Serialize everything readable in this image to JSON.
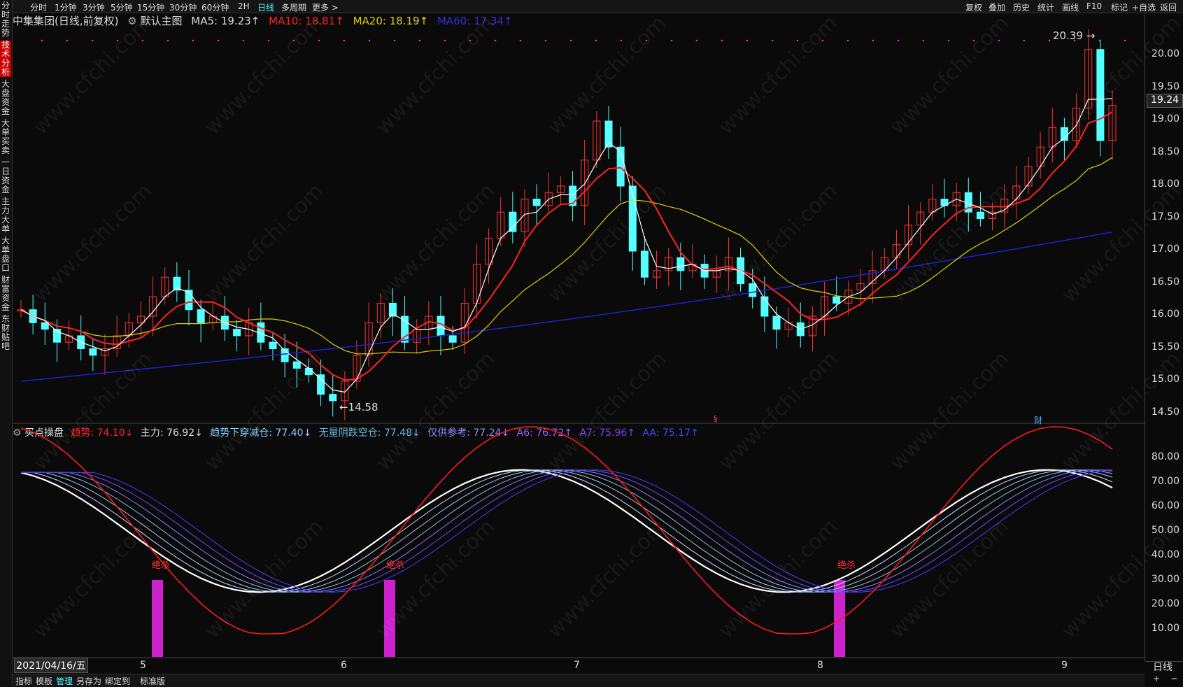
{
  "left_tabs": [
    "分时走势",
    "技术分析",
    "大盘资金",
    "大单买卖",
    "一日资金",
    "主力大单",
    "大单盘口",
    "财富资金",
    "东财贴吧"
  ],
  "top_left": [
    "分时",
    "1分钟",
    "3分钟",
    "5分钟",
    "15分钟",
    "30分钟",
    "60分钟",
    "2H",
    "日线",
    "多周期",
    "更多 >"
  ],
  "top_right": [
    "复权",
    "叠加",
    "历史",
    "统计",
    "画线",
    "F10",
    "标记",
    "+自选",
    "返回"
  ],
  "main": {
    "stock": "中集集团(日线,前复权)",
    "template": "默认主图",
    "ma5": "MA5: 19.23↑",
    "ma10": "MA10: 18.81↑",
    "ma20": "MA20: 18.19↑",
    "ma60": "MA60: 17.34↑",
    "high_label": "20.39",
    "low_label": "14.58",
    "current_price": "19.24",
    "y_ticks": [
      "20.00",
      "19.50",
      "19.00",
      "18.50",
      "18.00",
      "17.50",
      "17.00",
      "16.50",
      "16.00",
      "15.50",
      "15.00",
      "14.50"
    ],
    "marker_cai": "财"
  },
  "sub": {
    "name": "买点操盘",
    "trend": "趋势: 74.10↓",
    "zhuli": "主力: 76.92↓",
    "qushi": "趋势下穿减仓: 77.40↓",
    "wuliang": "无量阴跌空仓: 77.48↓",
    "jingong": "仅供参考: 77.24↓",
    "a6": "A6: 76.72↑",
    "a7": "A7: 75.96↑",
    "aa": "AA: 75.17↑",
    "signal_label": "绝杀",
    "y_ticks": [
      "80.00",
      "70.00",
      "60.00",
      "50.00",
      "40.00",
      "30.00",
      "20.00",
      "10.00"
    ]
  },
  "x_axis": {
    "date": "2021/04/16/五",
    "months": [
      "5",
      "6",
      "7",
      "8",
      "9"
    ],
    "period": "日线"
  },
  "bottom": [
    "指标",
    "模板",
    "管理",
    "另存为",
    "绑定到",
    "标准版"
  ],
  "watermark": "www.cfchi.com",
  "colors": {
    "up": "#ff3333",
    "down": "#55ffff",
    "ma5": "#ffffff",
    "ma10": "#ff2222",
    "ma20": "#e0d000",
    "ma60": "#2020d0"
  }
}
